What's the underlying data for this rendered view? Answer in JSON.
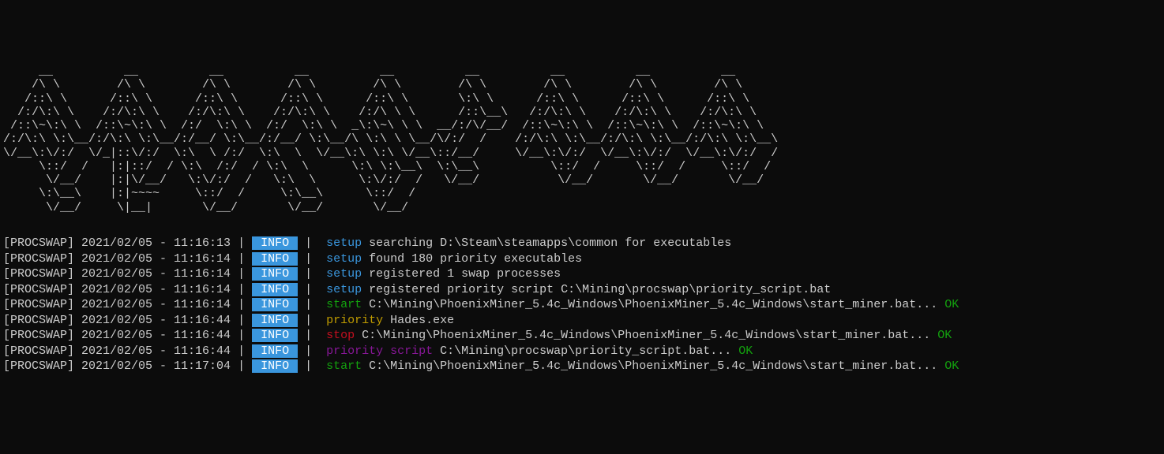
{
  "ascii_art": "     __          __          __          __          __          __          __          __          __\n    /\\ \\        /\\ \\        /\\ \\        /\\ \\        /\\ \\        /\\ \\        /\\ \\        /\\ \\        /\\ \\\n   /::\\ \\      /::\\ \\      /::\\ \\      /::\\ \\      /::\\ \\       \\:\\ \\      /::\\ \\      /::\\ \\      /::\\ \\\n  /:/\\:\\ \\    /:/\\:\\ \\    /:/\\:\\ \\    /:/\\:\\ \\    /:/\\ \\ \\      /::\\__\\   /:/\\:\\ \\    /:/\\:\\ \\    /:/\\:\\ \\\n /::\\~\\:\\ \\  /::\\~\\:\\ \\  /:/  \\:\\ \\  /:/  \\:\\ \\  _\\:\\~\\ \\ \\  __/:/\\/__/  /::\\~\\:\\ \\  /::\\~\\:\\ \\  /::\\~\\:\\ \\\n/:/\\:\\ \\:\\__/:/\\:\\ \\:\\__/:/__/ \\:\\__/:/__/ \\:\\__/\\ \\:\\ \\ \\__/\\/:/  /    /:/\\:\\ \\:\\__/:/\\:\\ \\:\\__/:/\\:\\ \\:\\__\\\n\\/__\\:\\/:/  \\/_|::\\/:/  \\:\\  \\ /:/  \\:\\  \\  \\/__\\:\\ \\:\\ \\/__\\::/__/     \\/__\\:\\/:/  \\/__\\:\\/:/  \\/__\\:\\/:/  /\n     \\::/  /   |:|::/  / \\:\\  /:/  / \\:\\  \\      \\:\\ \\:\\__\\  \\:\\__\\          \\::/  /     \\::/  /     \\::/  /\n      \\/__/    |:|\\/__/   \\:\\/:/  /   \\:\\  \\      \\:\\/:/  /   \\/__/           \\/__/       \\/__/       \\/__/\n     \\:\\__\\    |:|~~~~     \\::/  /     \\:\\__\\      \\::/  /\n      \\/__/     \\|__|       \\/__/       \\/__/       \\/__/",
  "log_prefix": "[PROCSWAP]",
  "level_labels": {
    "info": " INFO "
  },
  "lines": [
    {
      "timestamp": "2021/02/05 - 11:16:13",
      "level": "info",
      "category": "setup",
      "category_class": "setup",
      "message": "searching D:\\Steam\\steamapps\\common for executables",
      "status": ""
    },
    {
      "timestamp": "2021/02/05 - 11:16:14",
      "level": "info",
      "category": "setup",
      "category_class": "setup",
      "message": "found 180 priority executables",
      "status": ""
    },
    {
      "timestamp": "2021/02/05 - 11:16:14",
      "level": "info",
      "category": "setup",
      "category_class": "setup",
      "message": "registered 1 swap processes",
      "status": ""
    },
    {
      "timestamp": "2021/02/05 - 11:16:14",
      "level": "info",
      "category": "setup",
      "category_class": "setup",
      "message": "registered priority script C:\\Mining\\procswap\\priority_script.bat",
      "status": ""
    },
    {
      "timestamp": "2021/02/05 - 11:16:14",
      "level": "info",
      "category": "start",
      "category_class": "start",
      "message": "C:\\Mining\\PhoenixMiner_5.4c_Windows\\PhoenixMiner_5.4c_Windows\\start_miner.bat...",
      "status": "OK"
    },
    {
      "timestamp": "2021/02/05 - 11:16:44",
      "level": "info",
      "category": "priority",
      "category_class": "priority",
      "message": "Hades.exe",
      "status": ""
    },
    {
      "timestamp": "2021/02/05 - 11:16:44",
      "level": "info",
      "category": "stop",
      "category_class": "stop",
      "message": "C:\\Mining\\PhoenixMiner_5.4c_Windows\\PhoenixMiner_5.4c_Windows\\start_miner.bat...",
      "status": "OK"
    },
    {
      "timestamp": "2021/02/05 - 11:16:44",
      "level": "info",
      "category": "priority script",
      "category_class": "priority-purple",
      "message": "C:\\Mining\\procswap\\priority_script.bat...",
      "status": "OK"
    },
    {
      "timestamp": "2021/02/05 - 11:17:04",
      "level": "info",
      "category": "start",
      "category_class": "start",
      "message": "C:\\Mining\\PhoenixMiner_5.4c_Windows\\PhoenixMiner_5.4c_Windows\\start_miner.bat...",
      "status": "OK"
    }
  ]
}
